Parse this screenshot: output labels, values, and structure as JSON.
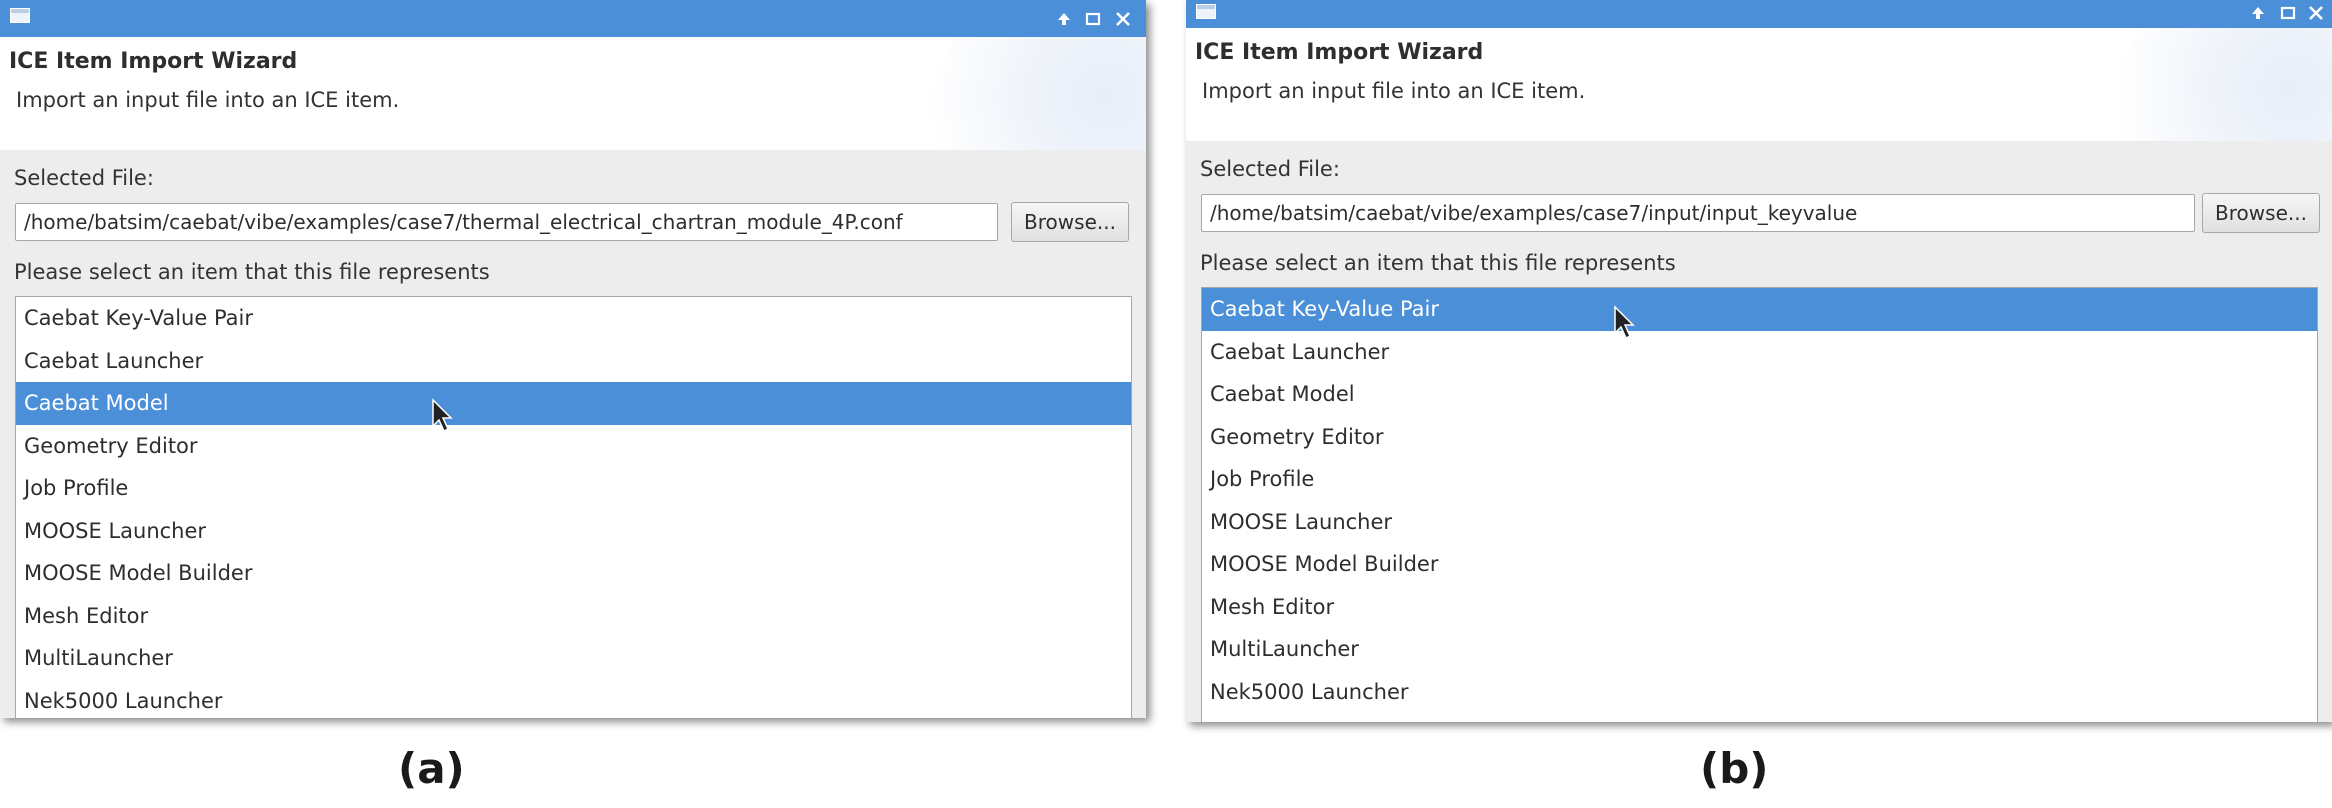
{
  "panels": [
    {
      "caption": "(a)",
      "header": {
        "title": "ICE Item Import Wizard",
        "description": "Import an input file into an ICE item."
      },
      "selected_file_label": "Selected File:",
      "selected_file_value": "/home/batsim/caebat/vibe/examples/case7/thermal_electrical_chartran_module_4P.conf",
      "browse_label": "Browse...",
      "list_prompt": "Please select an item that this file represents",
      "items": [
        "Caebat Key-Value Pair",
        "Caebat Launcher",
        "Caebat Model",
        "Geometry Editor",
        "Job Profile",
        "MOOSE Launcher",
        "MOOSE Model Builder",
        "Mesh Editor",
        "MultiLauncher",
        "Nek5000 Launcher"
      ],
      "selected_item": "Caebat Model"
    },
    {
      "caption": "(b)",
      "header": {
        "title": "ICE Item Import Wizard",
        "description": "Import an input file into an ICE item."
      },
      "selected_file_label": "Selected File:",
      "selected_file_value": "/home/batsim/caebat/vibe/examples/case7/input/input_keyvalue",
      "browse_label": "Browse...",
      "list_prompt": "Please select an item that this file represents",
      "items": [
        "Caebat Key-Value Pair",
        "Caebat Launcher",
        "Caebat Model",
        "Geometry Editor",
        "Job Profile",
        "MOOSE Launcher",
        "MOOSE Model Builder",
        "Mesh Editor",
        "MultiLauncher",
        "Nek5000 Launcher"
      ],
      "selected_item": "Caebat Key-Value Pair"
    }
  ],
  "icons": {
    "window_menu": "window-menu-icon",
    "titlebar_buttons": [
      "arrow-up-icon",
      "maximize-icon",
      "close-icon"
    ],
    "pointer": "mouse-cursor-icon"
  },
  "colors": {
    "titlebar": "#4a8fd8",
    "selection": "#4a8fd8",
    "dialog_bg": "#ededed",
    "header_bg": "#ffffff"
  }
}
